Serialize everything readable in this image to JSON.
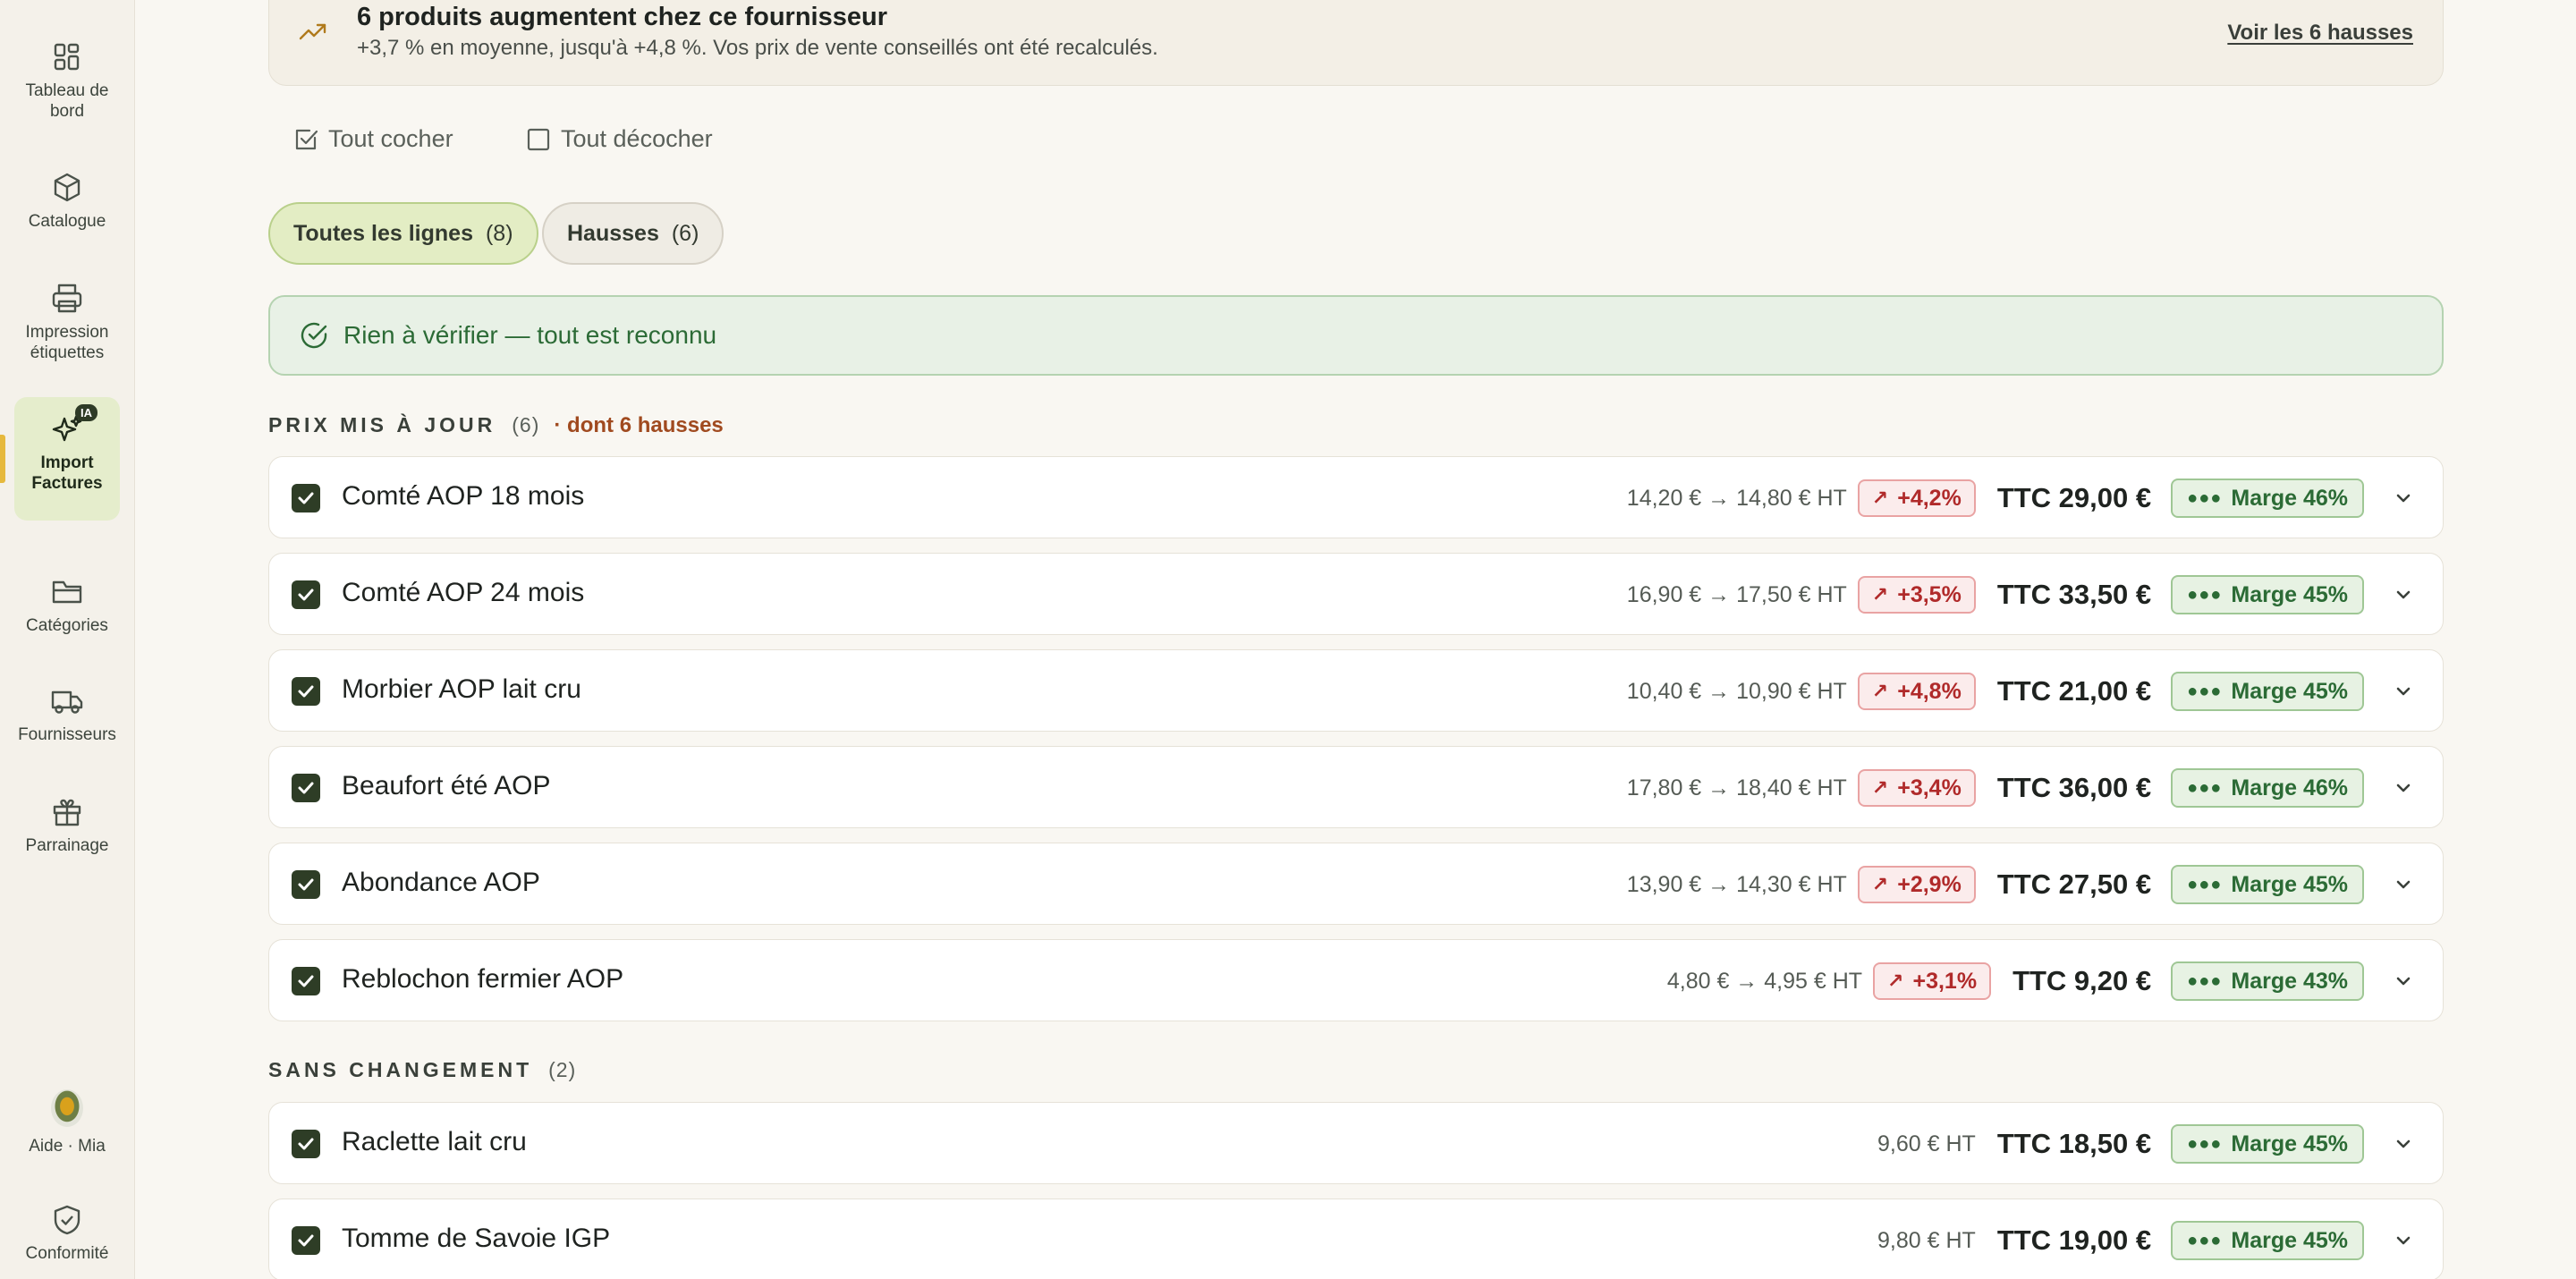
{
  "sidebar": {
    "items": [
      {
        "label": "Tableau de bord",
        "icon": "dashboard-icon"
      },
      {
        "label": "Catalogue",
        "icon": "box-icon"
      },
      {
        "label": "Impression étiquettes",
        "icon": "printer-icon"
      },
      {
        "label": "Import Factures",
        "icon": "sparkle-icon",
        "badge": "IA",
        "active": true
      },
      {
        "label": "Catégories",
        "icon": "folder-icon"
      },
      {
        "label": "Fournisseurs",
        "icon": "truck-icon"
      },
      {
        "label": "Parrainage",
        "icon": "gift-icon"
      }
    ],
    "bottom": [
      {
        "label": "Aide · Mia",
        "icon": "avatar-mia"
      },
      {
        "label": "Conformité",
        "icon": "shield-check-icon"
      }
    ]
  },
  "banner": {
    "title": "6 produits augmentent chez ce fournisseur",
    "subtitle": "+3,7 % en moyenne, jusqu'à +4,8 %. Vos prix de vente conseillés ont été recalculés.",
    "link": "Voir les 6 hausses"
  },
  "bulk": {
    "check_all": "Tout cocher",
    "uncheck_all": "Tout décocher"
  },
  "filters": [
    {
      "label": "Toutes les lignes",
      "count": "(8)",
      "active": true
    },
    {
      "label": "Hausses",
      "count": "(6)",
      "active": false
    }
  ],
  "status": {
    "text": "Rien à vérifier — tout est reconnu"
  },
  "sections": {
    "updated": {
      "title": "PRIX MIS À JOUR",
      "count": "(6)",
      "extra": "· dont 6 hausses"
    },
    "unchanged": {
      "title": "SANS CHANGEMENT",
      "count": "(2)"
    }
  },
  "rows_updated": [
    {
      "name": "Comté AOP 18 mois",
      "price": "14,20 € → 14,80 € HT",
      "pct": "+4,2%",
      "ttc": "TTC 29,00 €",
      "marge": "Marge 46%"
    },
    {
      "name": "Comté AOP 24 mois",
      "price": "16,90 € → 17,50 € HT",
      "pct": "+3,5%",
      "ttc": "TTC 33,50 €",
      "marge": "Marge 45%"
    },
    {
      "name": "Morbier AOP lait cru",
      "price": "10,40 € → 10,90 € HT",
      "pct": "+4,8%",
      "ttc": "TTC 21,00 €",
      "marge": "Marge 45%"
    },
    {
      "name": "Beaufort été AOP",
      "price": "17,80 € → 18,40 € HT",
      "pct": "+3,4%",
      "ttc": "TTC 36,00 €",
      "marge": "Marge 46%"
    },
    {
      "name": "Abondance AOP",
      "price": "13,90 € → 14,30 € HT",
      "pct": "+2,9%",
      "ttc": "TTC 27,50 €",
      "marge": "Marge 45%"
    },
    {
      "name": "Reblochon fermier AOP",
      "price": "4,80 € → 4,95 € HT",
      "pct": "+3,1%",
      "ttc": "TTC 9,20 €",
      "marge": "Marge 43%"
    }
  ],
  "rows_unchanged": [
    {
      "name": "Raclette lait cru",
      "price": "9,60 € HT",
      "ttc": "TTC 18,50 €",
      "marge": "Marge 45%"
    },
    {
      "name": "Tomme de Savoie IGP",
      "price": "9,80 € HT",
      "ttc": "TTC 19,00 €",
      "marge": "Marge 45%"
    }
  ],
  "colors": {
    "accent_green": "#2e3d26",
    "increase_red": "#b02a2a",
    "margin_green": "#2b6b35",
    "active_nav": "#e5edcc"
  }
}
